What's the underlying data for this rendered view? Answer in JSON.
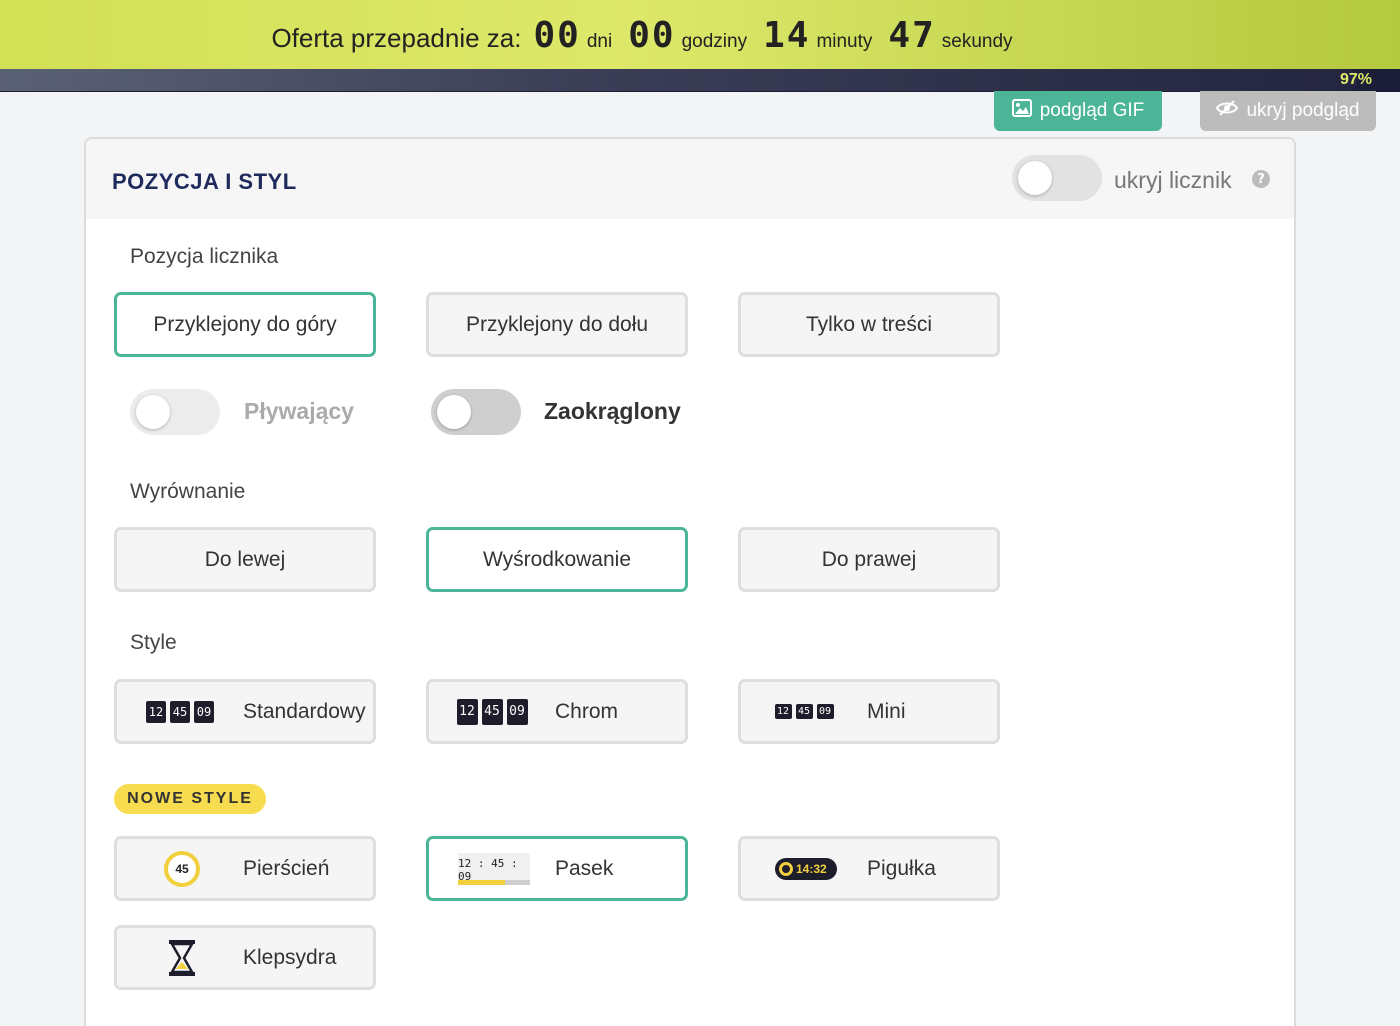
{
  "countdown": {
    "label": "Oferta przepadnie za:",
    "days": "00",
    "days_unit": "dni",
    "hours": "00",
    "hours_unit": "godziny",
    "minutes": "14",
    "minutes_unit": "minuty",
    "seconds": "47",
    "seconds_unit": "sekundy",
    "progress_percent": 97,
    "progress_label": "97%"
  },
  "toolbar": {
    "gif_preview_label": "podgląd GIF",
    "hide_preview_label": "ukryj podgląd"
  },
  "panel": {
    "title": "POZYCJA I STYL",
    "hide_counter_label": "ukryj licznik",
    "hide_counter_on": false,
    "help_glyph": "?"
  },
  "position": {
    "label": "Pozycja licznika",
    "options": [
      {
        "label": "Przyklejony do góry",
        "active": true
      },
      {
        "label": "Przyklejony do dołu",
        "active": false
      },
      {
        "label": "Tylko w treści",
        "active": false
      }
    ],
    "floating_label": "Pływający",
    "floating_on": false,
    "rounded_label": "Zaokrąglony",
    "rounded_on": false
  },
  "alignment": {
    "label": "Wyrównanie",
    "options": [
      {
        "label": "Do lewej",
        "active": false
      },
      {
        "label": "Wyśrodkowanie",
        "active": true
      },
      {
        "label": "Do prawej",
        "active": false
      }
    ]
  },
  "style": {
    "label": "Style",
    "sample_digits": [
      "12",
      "45",
      "09"
    ],
    "options": [
      {
        "label": "Standardowy",
        "active": false
      },
      {
        "label": "Chrom",
        "active": false
      },
      {
        "label": "Mini",
        "active": false
      }
    ]
  },
  "new_styles": {
    "badge": "NOWE STYLE",
    "ring_value": "45",
    "stripe_time": "12 : 45 : 09",
    "stripe_progress": 0.65,
    "pill_time": "14:32",
    "options": [
      {
        "label": "Pierścień",
        "active": false
      },
      {
        "label": "Pasek",
        "active": true
      },
      {
        "label": "Pigułka",
        "active": false
      },
      {
        "label": "Klepsydra",
        "active": false
      }
    ]
  },
  "colors": {
    "accent": "#4cb597",
    "countdown_bg": "#dde86a",
    "progress_track": "#1c1d36",
    "badge_yellow": "#f6dc4e"
  },
  "icons": {
    "gif": "image-icon",
    "hide": "eye-slash-icon",
    "help": "question-circle-icon",
    "hourglass": "hourglass-icon"
  }
}
